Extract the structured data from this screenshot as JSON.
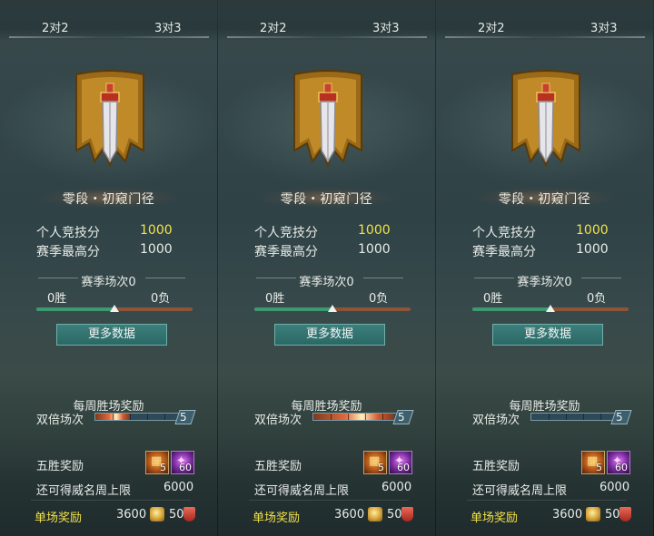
{
  "panels": [
    {
      "tabs": [
        "2对2",
        "3对3"
      ],
      "rank_name": "零段・初窥门径",
      "personal_score_label": "个人竞技分",
      "personal_score_value": "1000",
      "season_high_label": "赛季最高分",
      "season_high_value": "1000",
      "season_matches": "赛季场次0",
      "wins": "0胜",
      "losses": "0负",
      "win_ratio": 0.5,
      "more_data_button": "更多数据",
      "weekly_reward_title": "每周胜场奖励",
      "double_matches_label": "双倍场次",
      "double_matches_count": "5",
      "double_progress": 0.4,
      "five_win_label": "五胜奖励",
      "item1_count": "5",
      "item2_count": "60",
      "weekly_cap_label": "还可得威名周上限",
      "weekly_cap_value": "6000",
      "single_reward_label": "单场奖励",
      "single_reward_coin": "3600",
      "single_reward_shield": "50"
    },
    {
      "tabs": [
        "2对2",
        "3对3"
      ],
      "rank_name": "零段・初窥门径",
      "personal_score_label": "个人竞技分",
      "personal_score_value": "1000",
      "season_high_label": "赛季最高分",
      "season_high_value": "1000",
      "season_matches": "赛季场次0",
      "wins": "0胜",
      "losses": "0负",
      "win_ratio": 0.5,
      "more_data_button": "更多数据",
      "weekly_reward_title": "每周胜场奖励",
      "double_matches_label": "双倍场次",
      "double_matches_count": "5",
      "double_progress": 0.95,
      "five_win_label": "五胜奖励",
      "item1_count": "5",
      "item2_count": "60",
      "weekly_cap_label": "还可得威名周上限",
      "weekly_cap_value": "6000",
      "single_reward_label": "单场奖励",
      "single_reward_coin": "3600",
      "single_reward_shield": "50"
    },
    {
      "tabs": [
        "2对2",
        "3对3"
      ],
      "rank_name": "零段・初窥门径",
      "personal_score_label": "个人竞技分",
      "personal_score_value": "1000",
      "season_high_label": "赛季最高分",
      "season_high_value": "1000",
      "season_matches": "赛季场次0",
      "wins": "0胜",
      "losses": "0负",
      "win_ratio": 0.5,
      "more_data_button": "更多数据",
      "weekly_reward_title": "每周胜场奖励",
      "double_matches_label": "双倍场次",
      "double_matches_count": "5",
      "double_progress": 0.0,
      "five_win_label": "五胜奖励",
      "item1_count": "5",
      "item2_count": "60",
      "weekly_cap_label": "还可得威名周上限",
      "weekly_cap_value": "6000",
      "single_reward_label": "单场奖励",
      "single_reward_coin": "3600",
      "single_reward_shield": "50"
    }
  ],
  "colors": {
    "gold_text": "#f2e24a",
    "win_bar": "#3d9a6e",
    "loss_bar": "#8c5538",
    "button": "#2a6866"
  }
}
